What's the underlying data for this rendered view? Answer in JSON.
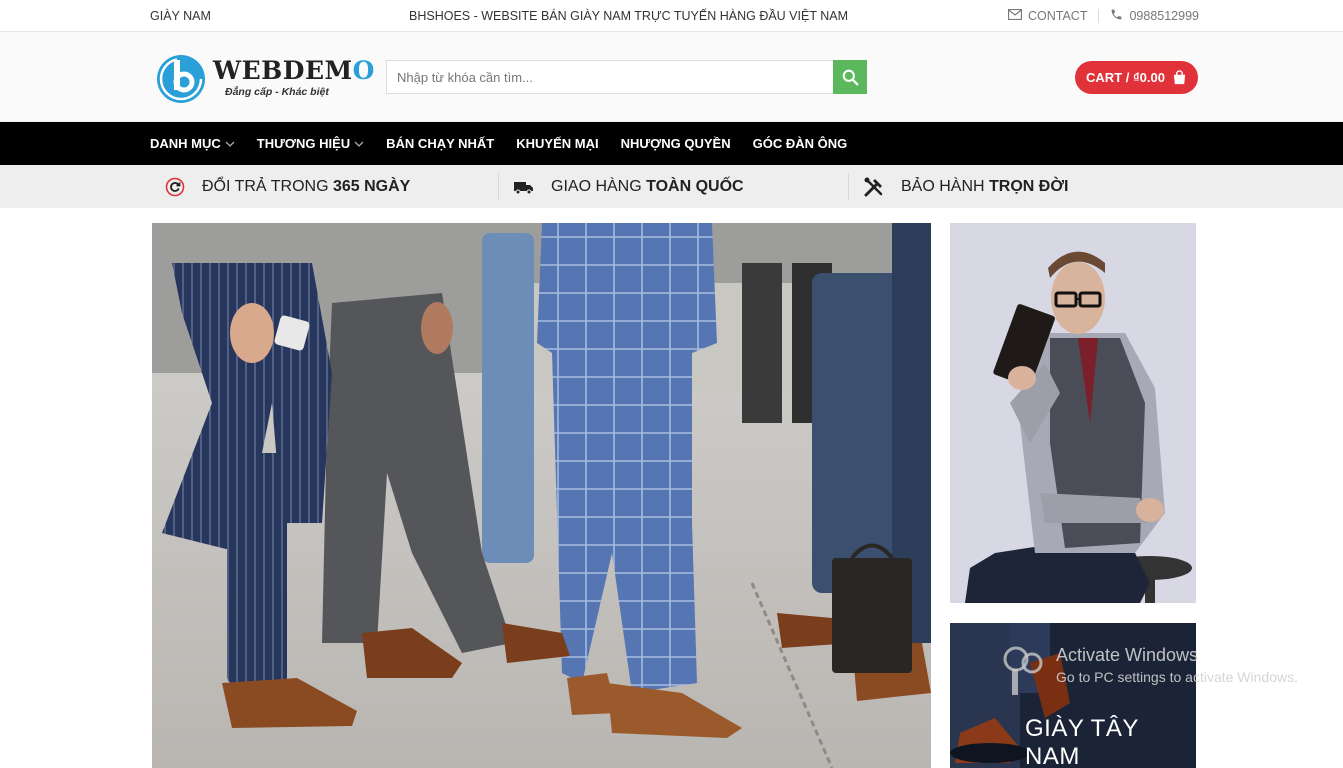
{
  "topbar": {
    "left_text": "GIÀY NAM",
    "center_text": "BHSHOES - WEBSITE BÁN GIÀY NAM TRỰC TUYẾN HÀNG ĐẦU VIỆT NAM",
    "contact_label": "CONTACT",
    "phone": "0988512999"
  },
  "header": {
    "logo_name_main": "WEBDEM",
    "logo_name_o": "O",
    "logo_tagline": "Đẳng cấp - Khác biệt",
    "search_placeholder": "Nhập từ khóa cần tìm...",
    "cart_label": "CART / ₫0.00"
  },
  "nav": {
    "items": [
      {
        "label": "DANH MỤC",
        "has_dropdown": true
      },
      {
        "label": "THƯƠNG HIỆU",
        "has_dropdown": true
      },
      {
        "label": "BÁN CHẠY NHẤT",
        "has_dropdown": false
      },
      {
        "label": "KHUYẾN MẠI",
        "has_dropdown": false
      },
      {
        "label": "NHƯỢNG QUYỀN",
        "has_dropdown": false
      },
      {
        "label": "GÓC ĐÀN ÔNG",
        "has_dropdown": false
      }
    ]
  },
  "features": [
    {
      "icon": "return-icon",
      "text": "ĐỔI TRẢ TRONG ",
      "bold": "365 NGÀY"
    },
    {
      "icon": "truck-icon",
      "text": "GIAO HÀNG ",
      "bold": "TOÀN QUỐC"
    },
    {
      "icon": "tools-icon",
      "text": "BẢO HÀNH ",
      "bold": "TRỌN ĐỜI"
    }
  ],
  "banners": {
    "side_banner_label": "GIÀY TÂY NAM"
  },
  "watermark": {
    "title": "Activate Windows",
    "subtitle": "Go to PC settings to activate Windows."
  },
  "colors": {
    "accent_red": "#e03238",
    "search_green": "#5cb85c",
    "logo_blue": "#2a9fd8",
    "nav_bg": "#000000"
  }
}
